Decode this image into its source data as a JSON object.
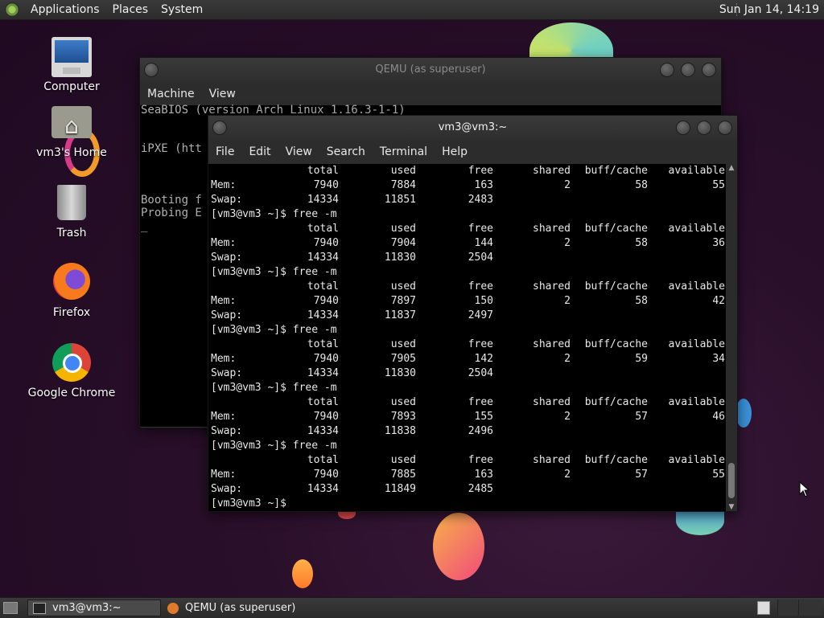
{
  "top_panel": {
    "menus": [
      "Applications",
      "Places",
      "System"
    ],
    "clock": "Sun Jan 14, 14:19"
  },
  "desktop_icons": [
    {
      "label": "Computer",
      "icon": "computer-icon"
    },
    {
      "label": "vm3's Home",
      "icon": "home-folder-icon"
    },
    {
      "label": "Trash",
      "icon": "trash-icon"
    },
    {
      "label": "Firefox",
      "icon": "firefox-icon"
    },
    {
      "label": "Google Chrome",
      "icon": "chrome-icon"
    }
  ],
  "qemu_window": {
    "title": "QEMU (as superuser)",
    "menus": [
      "Machine",
      "View"
    ],
    "screen_lines": [
      "SeaBIOS (version Arch Linux 1.16.3-1-1)",
      "",
      "iPXE (htt",
      "",
      "Booting f",
      "Probing E",
      "_"
    ]
  },
  "terminal_window": {
    "title": "vm3@vm3:~",
    "menus": [
      "File",
      "Edit",
      "View",
      "Search",
      "Terminal",
      "Help"
    ],
    "header": [
      "total",
      "used",
      "free",
      "shared",
      "buff/cache",
      "available"
    ],
    "prompt": "[vm3@vm3 ~]$ ",
    "command": "free -m",
    "blocks": [
      {
        "mem": [
          "7940",
          "7884",
          "163",
          "2",
          "58",
          "55"
        ],
        "swap": [
          "14334",
          "11851",
          "2483"
        ]
      },
      {
        "mem": [
          "7940",
          "7904",
          "144",
          "2",
          "58",
          "36"
        ],
        "swap": [
          "14334",
          "11830",
          "2504"
        ]
      },
      {
        "mem": [
          "7940",
          "7897",
          "150",
          "2",
          "58",
          "42"
        ],
        "swap": [
          "14334",
          "11837",
          "2497"
        ]
      },
      {
        "mem": [
          "7940",
          "7905",
          "142",
          "2",
          "59",
          "34"
        ],
        "swap": [
          "14334",
          "11830",
          "2504"
        ]
      },
      {
        "mem": [
          "7940",
          "7893",
          "155",
          "2",
          "57",
          "46"
        ],
        "swap": [
          "14334",
          "11838",
          "2496"
        ]
      },
      {
        "mem": [
          "7940",
          "7885",
          "163",
          "2",
          "57",
          "55"
        ],
        "swap": [
          "14334",
          "11849",
          "2485"
        ]
      }
    ],
    "mem_label": "Mem:",
    "swap_label": "Swap:"
  },
  "taskbar": {
    "tasks": [
      "vm3@vm3:~",
      "QEMU (as superuser)"
    ]
  }
}
